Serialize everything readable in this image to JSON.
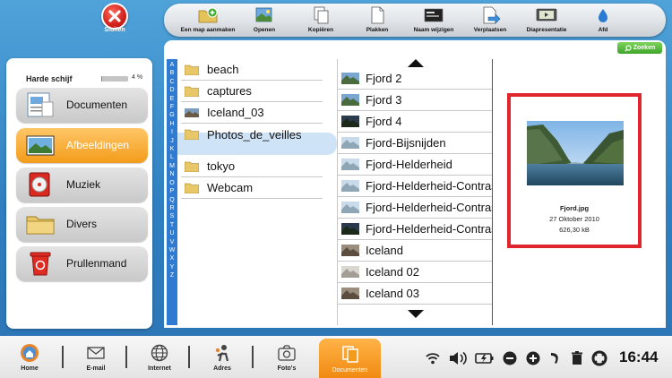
{
  "app": {
    "close_label": "Sluiten"
  },
  "toolbar": {
    "items": [
      {
        "label": "Een map aanmaken",
        "icon": "new-folder-icon"
      },
      {
        "label": "Openen",
        "icon": "open-icon"
      },
      {
        "label": "Kopiëren",
        "icon": "copy-icon"
      },
      {
        "label": "Plakken",
        "icon": "paste-icon"
      },
      {
        "label": "Naam wijzigen",
        "icon": "rename-icon"
      },
      {
        "label": "Verplaatsen",
        "icon": "move-icon"
      },
      {
        "label": "Diapresentatie",
        "icon": "slideshow-icon"
      },
      {
        "label": "Afd",
        "icon": "print-icon"
      }
    ]
  },
  "search": {
    "button_label": "Zoeken",
    "value": ""
  },
  "sidebar": {
    "disk_label": "Harde schijf",
    "disk_usage_fraction": 0.04,
    "disk_percent": "4 %",
    "categories": [
      {
        "label": "Documenten",
        "icon": "documents-icon",
        "active": false
      },
      {
        "label": "Afbeeldingen",
        "icon": "pictures-icon",
        "active": true
      },
      {
        "label": "Muziek",
        "icon": "music-icon",
        "active": false
      },
      {
        "label": "Divers",
        "icon": "folder-icon",
        "active": false
      },
      {
        "label": "Prullenmand",
        "icon": "trash-icon",
        "active": false
      }
    ]
  },
  "alphabet": [
    "A",
    "B",
    "C",
    "D",
    "E",
    "F",
    "G",
    "H",
    "I",
    "J",
    "K",
    "L",
    "M",
    "N",
    "O",
    "P",
    "Q",
    "R",
    "S",
    "T",
    "U",
    "V",
    "W",
    "X",
    "Y",
    "Z"
  ],
  "folders": [
    {
      "label": "beach",
      "type": "folder"
    },
    {
      "label": "captures",
      "type": "folder"
    },
    {
      "label": "Iceland_03",
      "type": "image-folder"
    },
    {
      "label": "Photos_de_veilles",
      "type": "folder",
      "selected": true
    },
    {
      "label": "tokyo",
      "type": "folder"
    },
    {
      "label": "Webcam",
      "type": "folder"
    }
  ],
  "files": [
    {
      "label": "Fjord 2",
      "thumb": "fjord"
    },
    {
      "label": "Fjord 3",
      "thumb": "fjord"
    },
    {
      "label": "Fjord 4",
      "thumb": "fjord-dark"
    },
    {
      "label": "Fjord-Bijsnijden",
      "thumb": "fjord-light"
    },
    {
      "label": "Fjord-Helderheid",
      "thumb": "fjord-light"
    },
    {
      "label": "Fjord-Helderheid-Contrast",
      "thumb": "fjord-light"
    },
    {
      "label": "Fjord-Helderheid-Contrast",
      "thumb": "fjord-light"
    },
    {
      "label": "Fjord-Helderheid-Contrast",
      "thumb": "fjord-dark"
    },
    {
      "label": "Iceland",
      "thumb": "iceland"
    },
    {
      "label": "Iceland 02",
      "thumb": "iceland-light"
    },
    {
      "label": "Iceland 03",
      "thumb": "iceland"
    }
  ],
  "preview": {
    "name": "Fjord.jpg",
    "date": "27 Oktober 2010",
    "size": "626,30 kB"
  },
  "bottom_nav": [
    {
      "label": "Home",
      "icon": "home-icon"
    },
    {
      "label": "E-mail",
      "icon": "email-icon"
    },
    {
      "label": "Internet",
      "icon": "globe-icon"
    },
    {
      "label": "Adres",
      "icon": "contacts-icon"
    },
    {
      "label": "Foto's",
      "icon": "camera-icon"
    },
    {
      "label": "Documenten",
      "icon": "documents-icon",
      "active": true
    }
  ],
  "status": {
    "clock": "16:44"
  },
  "colors": {
    "accent_orange": "#f39c1a",
    "alpha_blue": "#2f7bd1",
    "preview_border": "#e0262c",
    "search_green": "#3ea62a"
  }
}
